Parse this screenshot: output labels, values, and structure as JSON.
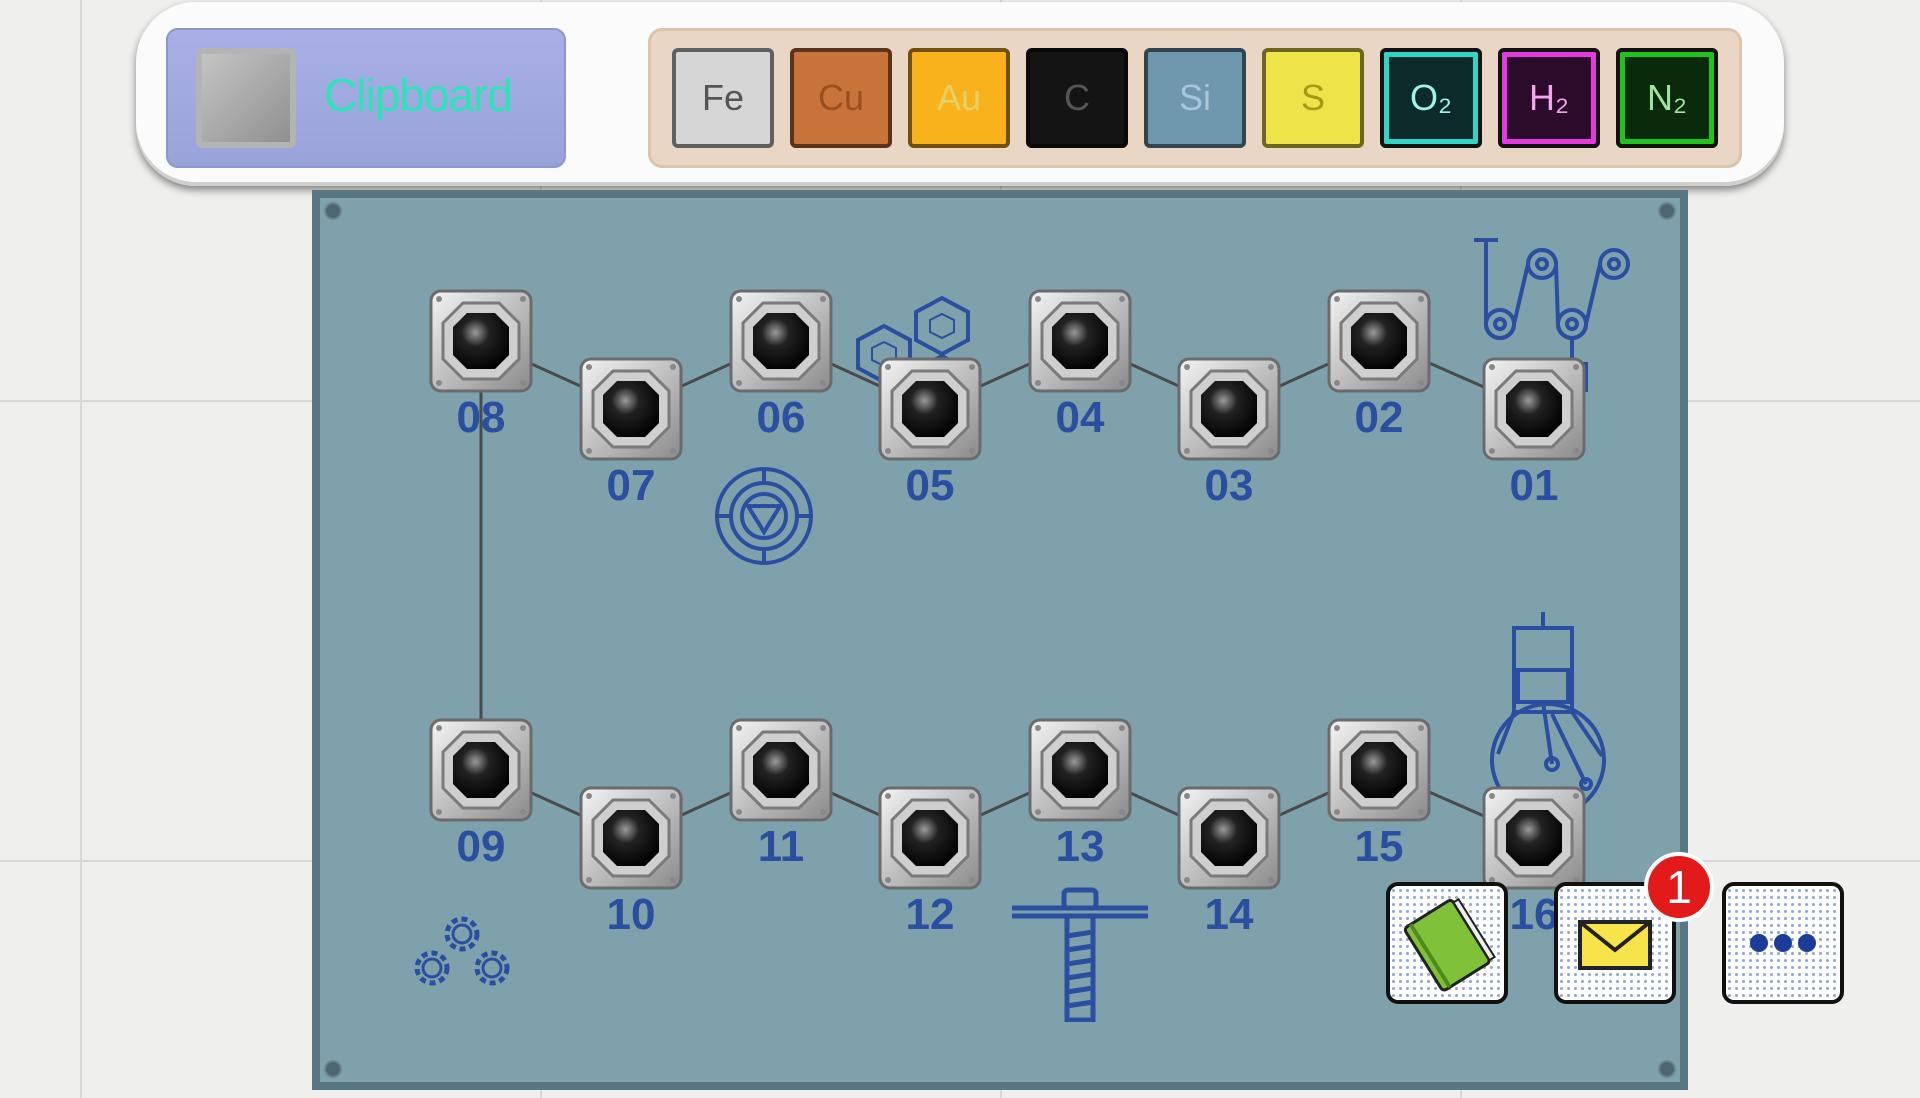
{
  "clipboard": {
    "label": "Clipboard"
  },
  "elements": [
    {
      "id": "fe",
      "label": "Fe",
      "bg": "#d6d6d6",
      "fg": "#555555"
    },
    {
      "id": "cu",
      "label": "Cu",
      "bg": "#c8733a",
      "fg": "#9a4f1e"
    },
    {
      "id": "au",
      "label": "Au",
      "bg": "#f7b21c",
      "fg": "#e7d06a"
    },
    {
      "id": "c",
      "label": "C",
      "bg": "#141414",
      "fg": "#555555"
    },
    {
      "id": "si",
      "label": "Si",
      "bg": "#6f97ad",
      "fg": "#a9c6d6"
    },
    {
      "id": "s",
      "label": "S",
      "bg": "#efe34a",
      "fg": "#a39a1a"
    },
    {
      "id": "o2",
      "label": "O₂",
      "bg": "#0c2a2a",
      "fg": "#9ff4e8",
      "ring": "#2fd6c6"
    },
    {
      "id": "h2",
      "label": "H₂",
      "bg": "#2a0c2a",
      "fg": "#f6a3ef",
      "ring": "#e33ae0"
    },
    {
      "id": "n2",
      "label": "N₂",
      "bg": "#0b2a0b",
      "fg": "#9fe49f",
      "ring": "#1fc41f"
    }
  ],
  "sockets": [
    "01",
    "02",
    "03",
    "04",
    "05",
    "06",
    "07",
    "08",
    "09",
    "10",
    "11",
    "12",
    "13",
    "14",
    "15",
    "16"
  ],
  "buttons": {
    "notebook": "notebook-icon",
    "mail": "mail-icon",
    "more": "more-icon"
  },
  "mail_badge": "1"
}
